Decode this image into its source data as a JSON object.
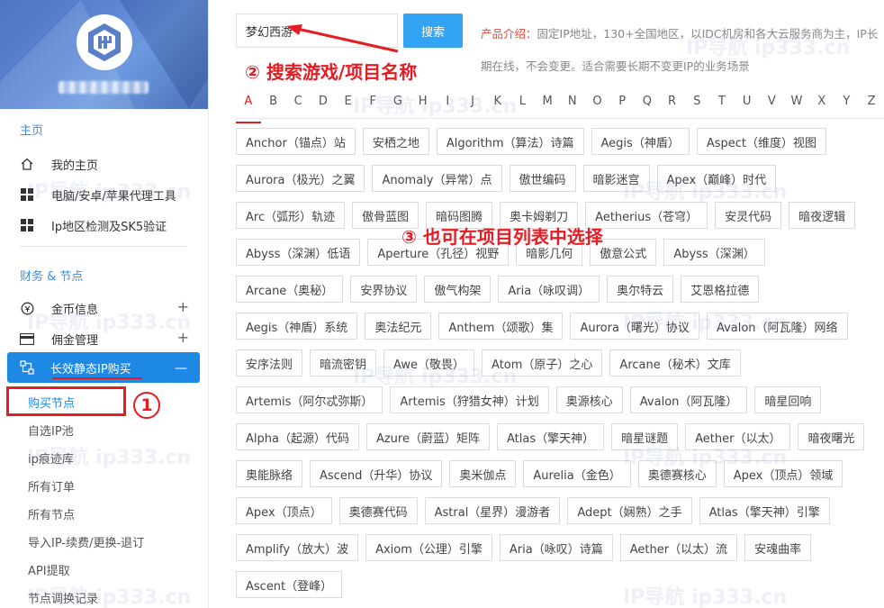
{
  "sidebar": {
    "section_home": "主页",
    "home_items": [
      {
        "label": "我的主页",
        "icon": "home-icon"
      },
      {
        "label": "电脑/安卓/苹果代理工具",
        "icon": "grid-icon"
      },
      {
        "label": "Ip地区检测及SK5验证",
        "icon": "grid-icon"
      }
    ],
    "section_finance": "财务 & 节点",
    "finance_items": [
      {
        "label": "金币信息",
        "icon": "coin-icon",
        "expand": "+"
      },
      {
        "label": "佣金管理",
        "icon": "card-icon",
        "expand": "+"
      }
    ],
    "active_item": {
      "label": "长效静态IP购买",
      "icon": "network-icon",
      "collapse": "—"
    },
    "sub_items": [
      "购买节点",
      "自选IP池",
      "ip痕迹库",
      "所有订单",
      "所有节点",
      "导入IP-续费/更换-退订",
      "API提取",
      "节点调换记录"
    ]
  },
  "annotations": {
    "one": "1",
    "two": "② 搜索游戏/项目名称",
    "three": "③ 也可在项目列表中选择"
  },
  "watermark": "IP导航 ip333.cn",
  "search": {
    "value": "梦幻西游",
    "button": "搜索"
  },
  "intro": {
    "label": "产品介绍：",
    "text": "固定IP地址，130+全国地区，以IDC机房和各大云服务商为主，IP长期在线，不会变更。适合需要长期不变更IP的业务场景"
  },
  "letters": [
    "A",
    "B",
    "C",
    "D",
    "E",
    "F",
    "G",
    "H",
    "I",
    "J",
    "K",
    "L",
    "M",
    "N",
    "O",
    "P",
    "Q",
    "R",
    "S",
    "T",
    "U",
    "V",
    "W",
    "X",
    "Y",
    "Z"
  ],
  "active_letter": "A",
  "tags": [
    "Anchor（锚点）站",
    "安栖之地",
    "Algorithm（算法）诗篇",
    "Aegis（神盾）",
    "Aspect（维度）视图",
    "Aurora（极光）之翼",
    "Anomaly（异常）点",
    "傲世编码",
    "暗影迷宫",
    "Apex（巅峰）时代",
    "Arc（弧形）轨迹",
    "傲骨蓝图",
    "暗码图腾",
    "奥卡姆剃刀",
    "Aetherius（苍穹）",
    "安灵代码",
    "暗夜逻辑",
    "Abyss（深渊）低语",
    "Aperture（孔径）视野",
    "暗影几何",
    "傲意公式",
    "Abyss（深渊）",
    "Arcane（奥秘）",
    "安界协议",
    "傲气构架",
    "Aria（咏叹调）",
    "奥尔特云",
    "艾恩格拉德",
    "Aegis（神盾）系统",
    "奥法纪元",
    "Anthem（颂歌）集",
    "Aurora（曙光）协议",
    "Avalon（阿瓦隆）网络",
    "安序法则",
    "暗流密钥",
    "Awe（敬畏）",
    "Atom（原子）之心",
    "Arcane（秘术）文库",
    "Artemis（阿尔忒弥斯）",
    "Artemis（狩猎女神）计划",
    "奥源核心",
    "Avalon（阿瓦隆）",
    "暗星回响",
    "Alpha（起源）代码",
    "Azure（蔚蓝）矩阵",
    "Atlas（擎天神）",
    "暗星谜题",
    "Aether（以太）",
    "暗夜曙光",
    "奥能脉络",
    "Ascend（升华）协议",
    "奥米伽点",
    "Aurelia（金色）",
    "奥德赛核心",
    "Apex（顶点）领域",
    "Apex（顶点）",
    "奥德赛代码",
    "Astral（星界）漫游者",
    "Adept（娴熟）之手",
    "Atlas（擎天神）引擎",
    "Amplify（放大）波",
    "Axiom（公理）引擎",
    "Aria（咏叹）诗篇",
    "Aether（以太）流",
    "安魂曲率",
    "Ascent（登峰）"
  ]
}
